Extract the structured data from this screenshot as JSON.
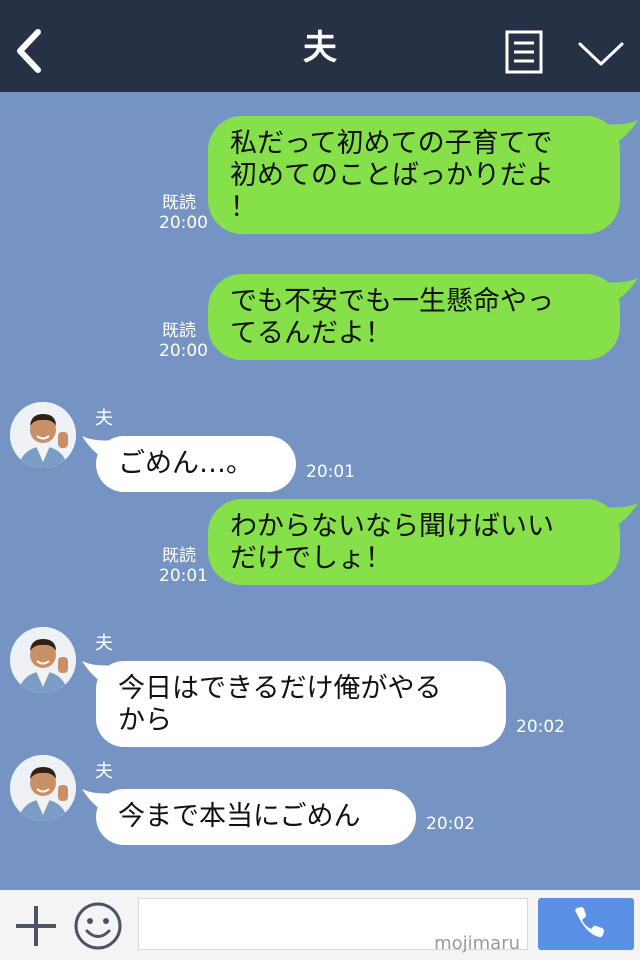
{
  "header": {
    "title": "夫",
    "back_icon": "chevron-left-icon",
    "menu_icon": "note-list-icon",
    "collapse_icon": "chevron-down-icon"
  },
  "messages": [
    {
      "direction": "sent",
      "lines": [
        "私だって初めての子育てで",
        "初めてのことばっかりだよ",
        "！"
      ],
      "read": "既読",
      "time": "20:00"
    },
    {
      "direction": "sent",
      "lines": [
        "でも不安でも一生懸命やっ",
        "てるんだよ！"
      ],
      "read": "既読",
      "time": "20:00"
    },
    {
      "direction": "received",
      "sender": "夫",
      "lines": [
        "ごめん…。"
      ],
      "time": "20:01"
    },
    {
      "direction": "sent",
      "lines": [
        "わからないなら聞けばいい",
        "だけでしょ！"
      ],
      "read": "既読",
      "time": "20:01"
    },
    {
      "direction": "received",
      "sender": "夫",
      "lines": [
        "今日はできるだけ俺がやる",
        "から"
      ],
      "time": "20:02"
    },
    {
      "direction": "received",
      "sender": "夫",
      "lines": [
        "今まで本当にごめん"
      ],
      "time": "20:02"
    }
  ],
  "footer": {
    "plus_icon": "plus-icon",
    "emoji_icon": "smiley-icon",
    "input_value": "",
    "watermark": "mojimaru",
    "call_icon": "phone-icon"
  },
  "colors": {
    "chat_background": "#7594c3",
    "header_background": "#263145",
    "sent_bubble": "#86e04a",
    "received_bubble": "#ffffff",
    "call_button": "#5a8fe6"
  }
}
